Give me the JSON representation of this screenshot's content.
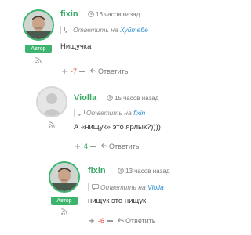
{
  "comments": [
    {
      "author": "fixin",
      "time": "16 часов назад",
      "badge": "Автор",
      "reply_prefix": "Ответить на",
      "reply_name": "Хуйтебе",
      "text": "Нищучка",
      "vote_count": "-7",
      "reply_label": "Ответить"
    },
    {
      "author": "Violla",
      "time": "15 часов назад",
      "reply_prefix": "Ответить на",
      "reply_name": "fixin",
      "text": "А «нищук» это ярлык?))))",
      "vote_count": "4",
      "reply_label": "Ответить"
    },
    {
      "author": "fixin",
      "time": "13 часов назад",
      "badge": "Автор",
      "reply_prefix": "Ответить на",
      "reply_name": "Violla",
      "text": "нищук это нищук",
      "vote_count": "-6",
      "reply_label": "Ответить"
    }
  ],
  "icons": {
    "clock": "clock-icon",
    "reply": "reply-icon",
    "rss": "rss-icon",
    "vote_up": "plus-icon",
    "vote_down": "minus-icon"
  },
  "colors": {
    "author": "#3aa865",
    "badge": "#3cb46e",
    "reply_link": "#2f8fcf",
    "negative": "#e14a2c",
    "positive": "#3aa865"
  }
}
